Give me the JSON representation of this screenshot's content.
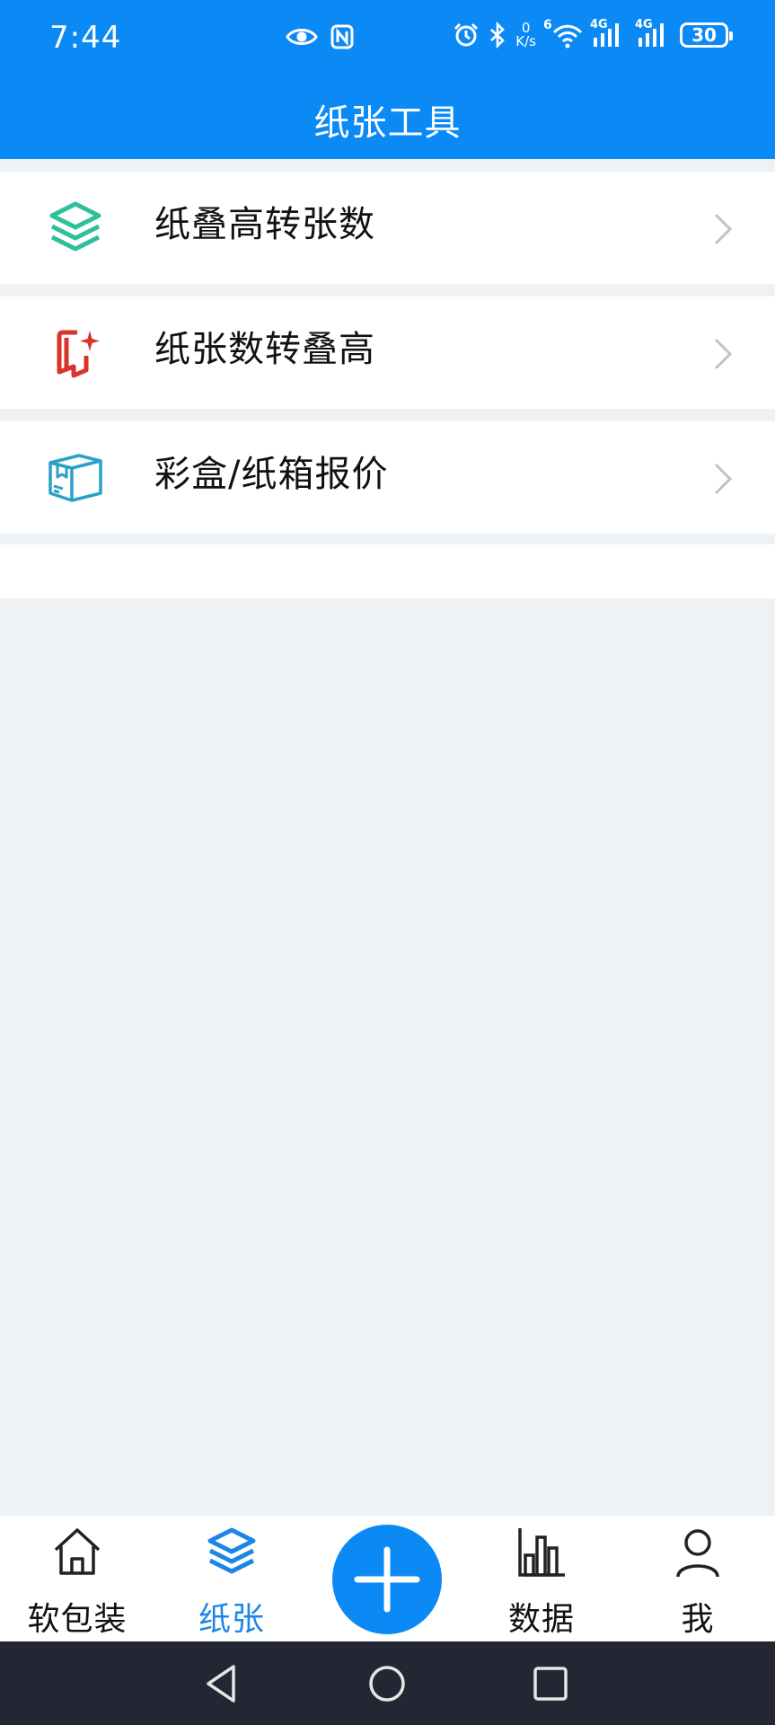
{
  "status_bar": {
    "time": "7:44",
    "speed_value": "0",
    "speed_unit": "K/s",
    "wifi_badge": "6",
    "network_1": "4G",
    "network_2": "4G",
    "battery": "30"
  },
  "header": {
    "title": "纸张工具"
  },
  "tools": [
    {
      "label": "纸叠高转张数",
      "icon": "layers-icon",
      "color": "#2fbf9b"
    },
    {
      "label": "纸张数转叠高",
      "icon": "convert-sparkle-icon",
      "color": "#d9342b"
    },
    {
      "label": "彩盒/纸箱报价",
      "icon": "box-icon",
      "color": "#2aa0c8"
    }
  ],
  "tabbar": {
    "items": [
      {
        "label": "软包装",
        "icon": "home-icon"
      },
      {
        "label": "纸张",
        "icon": "layers-icon",
        "active": true
      },
      {
        "label": "数据",
        "icon": "bar-chart-icon"
      },
      {
        "label": "我",
        "icon": "person-icon"
      }
    ],
    "fab_icon": "plus-icon"
  },
  "colors": {
    "primary": "#0b8af5",
    "active_tab": "#1c86e6",
    "background": "#eff2f5",
    "nav_bar": "#232733"
  }
}
